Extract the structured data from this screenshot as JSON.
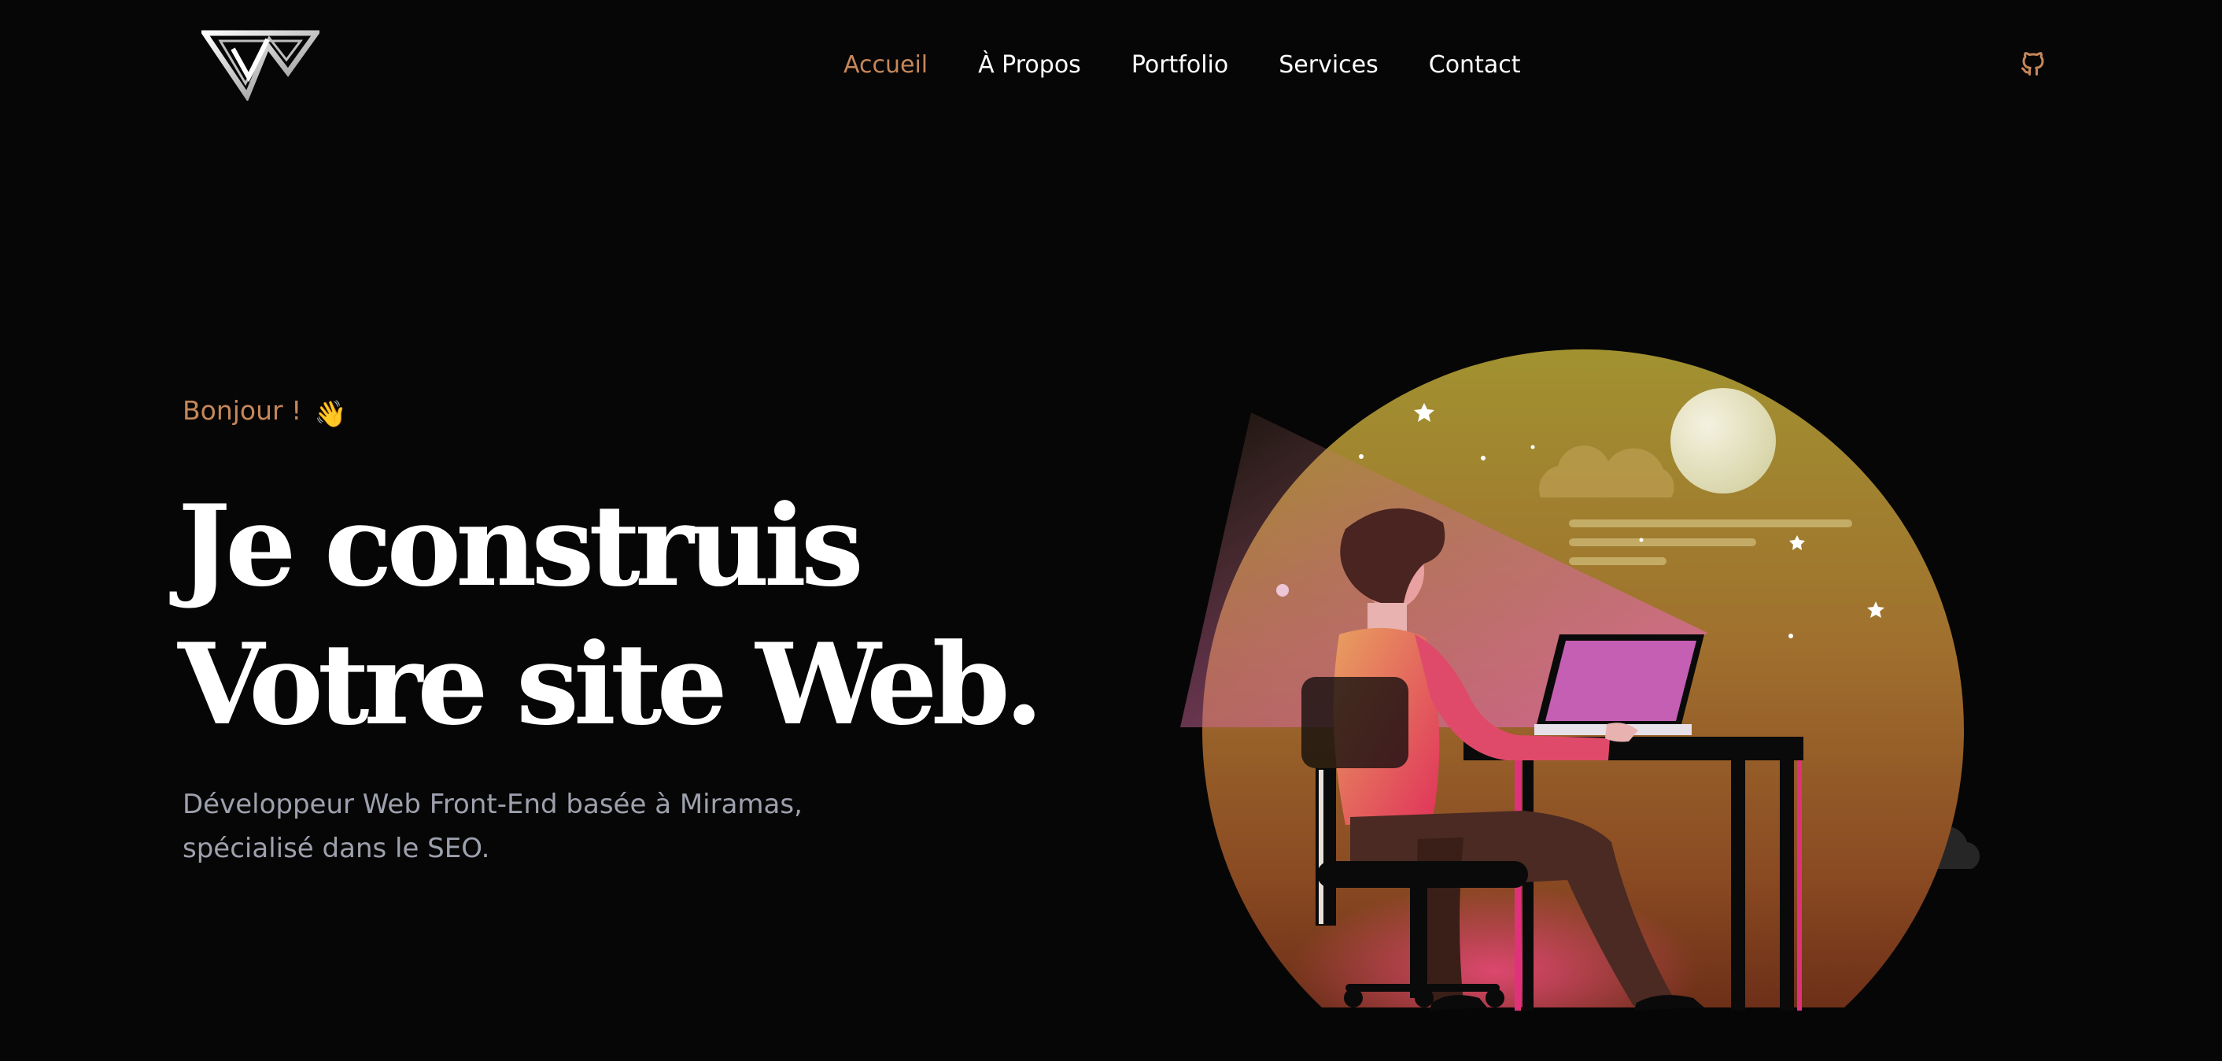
{
  "header": {
    "logo_icon": "w-monogram-logo",
    "nav": [
      {
        "label": "Accueil",
        "active": true
      },
      {
        "label": "À Propos",
        "active": false
      },
      {
        "label": "Portfolio",
        "active": false
      },
      {
        "label": "Services",
        "active": false
      },
      {
        "label": "Contact",
        "active": false
      }
    ],
    "github_icon": "github-icon"
  },
  "hero": {
    "greeting": "Bonjour !",
    "greeting_emoji": "👋",
    "headline_line1": "Je construis",
    "headline_line2": "Votre site Web.",
    "subtitle_line1": "Développeur Web Front-End basée à Miramas,",
    "subtitle_line2": "spécialisé dans le SEO.",
    "illustration": "developer-at-desk-night-illustration"
  },
  "colors": {
    "background": "#070606",
    "accent": "#c5875a",
    "text": "#ffffff",
    "muted": "#9da1ad"
  }
}
